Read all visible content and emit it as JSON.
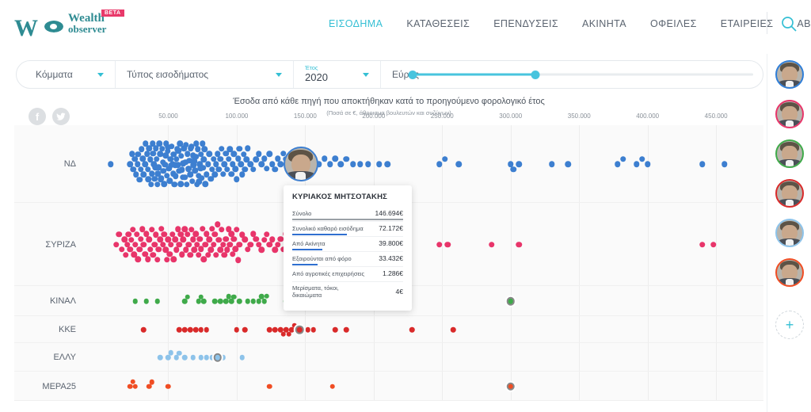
{
  "brand": {
    "name_line1": "Wealth",
    "name_line2": "observer",
    "mark": "W",
    "badge": "BETA",
    "color": "#2e8b92",
    "badge_color": "#e8396a"
  },
  "nav": {
    "items": [
      {
        "label": "ΕΙΣΟΔΗΜΑ",
        "active": true
      },
      {
        "label": "ΚΑΤΑΘΕΣΕΙΣ",
        "active": false
      },
      {
        "label": "ΕΠΕΝΔΥΣΕΙΣ",
        "active": false
      },
      {
        "label": "ΑΚΙΝΗΤΑ",
        "active": false
      },
      {
        "label": "ΟΦΕΙΛΕΣ",
        "active": false
      },
      {
        "label": "ΕΤΑΙΡΕΙΕΣ",
        "active": false
      },
      {
        "label": "ABOUT",
        "active": false
      }
    ],
    "active_color": "#34bfd4",
    "search_icon": "search-icon"
  },
  "filters": {
    "parties": {
      "label": "Κόμματα",
      "icon": "chevron-down-icon"
    },
    "income_type": {
      "label": "Τύπος εισοδήματος",
      "icon": "chevron-down-icon"
    },
    "year": {
      "caption": "Έτος",
      "value": "2020",
      "icon": "chevron-down-icon"
    },
    "range": {
      "label": "Εύρος",
      "low_pct": 0,
      "high_pct": 36,
      "accent": "#48c4de"
    }
  },
  "chart_header": {
    "title": "Έσοδα από κάθε πηγή που αποκτήθηκαν κατά το προηγούμενο φορολογικό έτος",
    "subtitle": "(Ποσά σε €, άθροισμα βουλευτών και συζύγων)",
    "share": [
      {
        "name": "facebook-icon",
        "glyph": "f"
      },
      {
        "name": "twitter-icon",
        "glyph": "🐦"
      }
    ]
  },
  "chart_data": {
    "type": "scatter",
    "title": "Έσοδα από κάθε πηγή που αποκτήθηκαν κατά το προηγούμενο φορολογικό έτος",
    "subtitle": "(Ποσά σε €, άθροισμα βουλευτών και συζύγων)",
    "xlabel": "",
    "ylabel": "",
    "xlim": [
      0,
      480000
    ],
    "grid": true,
    "legend": "none",
    "xticks": [
      "50.000",
      "100.000",
      "150.000",
      "200.000",
      "250.000",
      "300.000",
      "350.000",
      "400.000",
      "450.000"
    ],
    "xtick_values": [
      50000,
      100000,
      150000,
      200000,
      250000,
      300000,
      350000,
      400000,
      450000
    ],
    "categories": [
      "ΝΔ",
      "ΣΥΡΙΖΑ",
      "ΚΙΝΑΛ",
      "ΚΚΕ",
      "ΕΛΛΥ",
      "ΜΕΡΑ25"
    ],
    "series": [
      {
        "name": "ΝΔ",
        "color": "#3d7fd0",
        "values": [
          8000,
          22000,
          23500,
          24500,
          25500,
          26500,
          27500,
          28000,
          29000,
          30000,
          30500,
          31500,
          32000,
          33000,
          33500,
          34500,
          35000,
          35500,
          36000,
          37000,
          37500,
          38000,
          38500,
          39000,
          39500,
          40000,
          40500,
          41000,
          41500,
          42000,
          42500,
          43000,
          43500,
          44000,
          44500,
          45000,
          45500,
          46000,
          46500,
          47000,
          47500,
          48000,
          48500,
          49000,
          49500,
          50000,
          50500,
          51000,
          51500,
          52000,
          52500,
          53000,
          53500,
          54000,
          54500,
          55000,
          55500,
          56000,
          56500,
          57000,
          57500,
          58000,
          58500,
          59000,
          59500,
          60000,
          60500,
          61000,
          61500,
          62000,
          62500,
          63000,
          63500,
          64000,
          64500,
          65000,
          65500,
          66000,
          66500,
          67000,
          67500,
          68000,
          68500,
          69000,
          69500,
          70000,
          70500,
          71000,
          71500,
          72000,
          72500,
          73000,
          73500,
          74000,
          74500,
          75000,
          75500,
          76000,
          76500,
          77000,
          78000,
          79000,
          80000,
          81000,
          82000,
          83000,
          84000,
          85000,
          86000,
          87000,
          88000,
          89000,
          90000,
          91000,
          92000,
          93000,
          94000,
          95000,
          96000,
          97000,
          98000,
          99000,
          100000,
          101000,
          102000,
          103000,
          104000,
          105000,
          106000,
          107000,
          108000,
          110000,
          112000,
          114000,
          116000,
          118000,
          120000,
          122000,
          124000,
          126000,
          128000,
          130000,
          132000,
          134000,
          136000,
          138000,
          140000,
          142000,
          144000,
          146694,
          150000,
          153000,
          156000,
          160000,
          164000,
          168000,
          172000,
          176000,
          180000,
          185000,
          190000,
          196000,
          204000,
          210000,
          248000,
          252000,
          262000,
          300000,
          302000,
          306000,
          330000,
          342000,
          378000,
          382000,
          392000,
          396000,
          400000,
          440000,
          456000
        ],
        "highlight": {
          "label": "ΚΥΡΙΑΚΟΣ ΜΗΤΣΟΤΑΚΗΣ",
          "value": 146694,
          "type": "avatar"
        }
      },
      {
        "name": "ΣΥΡΙΖΑ",
        "color": "#e8356a",
        "values": [
          12000,
          14000,
          16000,
          18000,
          19000,
          20000,
          21000,
          22000,
          23000,
          24000,
          25000,
          26000,
          27000,
          28000,
          29000,
          30000,
          31000,
          32000,
          33000,
          34000,
          35000,
          36000,
          37000,
          38000,
          39000,
          40000,
          41000,
          42000,
          43000,
          44000,
          45000,
          46000,
          47000,
          48000,
          49000,
          50000,
          51000,
          52000,
          53000,
          54000,
          55000,
          56000,
          57000,
          58000,
          59000,
          60000,
          61000,
          62000,
          63000,
          64000,
          65000,
          66000,
          67000,
          68000,
          69000,
          70000,
          71000,
          72000,
          73000,
          74000,
          75000,
          76000,
          77000,
          78000,
          79000,
          80000,
          81000,
          82000,
          83000,
          84000,
          85000,
          86000,
          87000,
          88000,
          89000,
          90000,
          91000,
          92000,
          93000,
          94000,
          95000,
          96000,
          97000,
          98000,
          99000,
          100000,
          101000,
          102000,
          104000,
          106000,
          108000,
          110000,
          112000,
          114000,
          116000,
          118000,
          120000,
          122000,
          124000,
          126000,
          128000,
          130000,
          132000,
          134000,
          136000,
          138000,
          140000,
          142000,
          144000,
          146000,
          148000,
          150000,
          152000,
          155000,
          158000,
          162000,
          166000,
          170000,
          174000,
          178000,
          182000,
          186000,
          190000,
          196000,
          204000,
          212000,
          218000,
          248000,
          254000,
          286000,
          306000,
          440000,
          448000
        ],
        "highlight": {
          "value": 156000,
          "type": "ring"
        }
      },
      {
        "name": "ΚΙΝΑΛ",
        "color": "#3faa4a",
        "values": [
          26000,
          34000,
          42000,
          62000,
          64000,
          72000,
          74000,
          76000,
          84000,
          88000,
          92000,
          94000,
          96000,
          98000,
          102000,
          108000,
          112000,
          116000,
          118000,
          120000,
          122000,
          136000,
          140000,
          142000,
          144000,
          206000,
          300000
        ],
        "highlight": {
          "value": 300000,
          "type": "ring"
        }
      },
      {
        "name": "ΚΚΕ",
        "color": "#d92a2a",
        "values": [
          32000,
          58000,
          62000,
          66000,
          70000,
          74000,
          78000,
          100000,
          106000,
          124000,
          128000,
          132000,
          134000,
          136000,
          138000,
          140000,
          142000,
          152000,
          156000,
          172000,
          180000,
          228000,
          258000
        ],
        "highlight": {
          "value": 146000,
          "type": "ring"
        }
      },
      {
        "name": "ΕΛΛΥ",
        "color": "#8dc3ea",
        "values": [
          44000,
          50000,
          52000,
          56000,
          58000,
          62000,
          68000,
          74000,
          78000,
          82000,
          86000,
          90000,
          104000
        ],
        "highlight": {
          "value": 86000,
          "type": "ring"
        }
      },
      {
        "name": "ΜΕΡΑ25",
        "color": "#f04d23",
        "values": [
          22000,
          24000,
          26000,
          36000,
          38000,
          50000,
          124000,
          170000,
          300000
        ],
        "highlight": {
          "value": 300000,
          "type": "ring"
        }
      }
    ]
  },
  "tooltip": {
    "name": "ΚΥΡΙΑΚΟΣ ΜΗΤΣΟΤΑΚΗΣ",
    "rows": [
      {
        "key": "Σύνολο",
        "value": "146.694€",
        "bar_pct": 100,
        "bar_style": "total"
      },
      {
        "key": "Συνολικό καθαρό εισόδημα",
        "value": "72.172€",
        "bar_pct": 49,
        "bar_style": "blue"
      },
      {
        "key": "Από Ακίνητα",
        "value": "39.800€",
        "bar_pct": 27,
        "bar_style": "blue"
      },
      {
        "key": "Εξαιρούνται από φόρο",
        "value": "33.432€",
        "bar_pct": 23,
        "bar_style": "blue"
      },
      {
        "key": "Από αγροτικές επιχειρήσεις",
        "value": "1.286€",
        "bar_pct": 1,
        "bar_style": "none"
      },
      {
        "key": "Μερίσματα, τόκοι, δικαιώματα",
        "value": "4€",
        "bar_pct": 0,
        "bar_style": "none"
      }
    ]
  },
  "rail": {
    "avatars": [
      {
        "name": "avatar-nd",
        "ring": "#2f7ed8"
      },
      {
        "name": "avatar-syriza",
        "ring": "#e8356a"
      },
      {
        "name": "avatar-kinal",
        "ring": "#3faa4a"
      },
      {
        "name": "avatar-kke",
        "ring": "#d92a2a"
      },
      {
        "name": "avatar-elly",
        "ring": "#8dc3ea"
      },
      {
        "name": "avatar-mera25",
        "ring": "#f04d23"
      }
    ],
    "add_label": "+"
  }
}
